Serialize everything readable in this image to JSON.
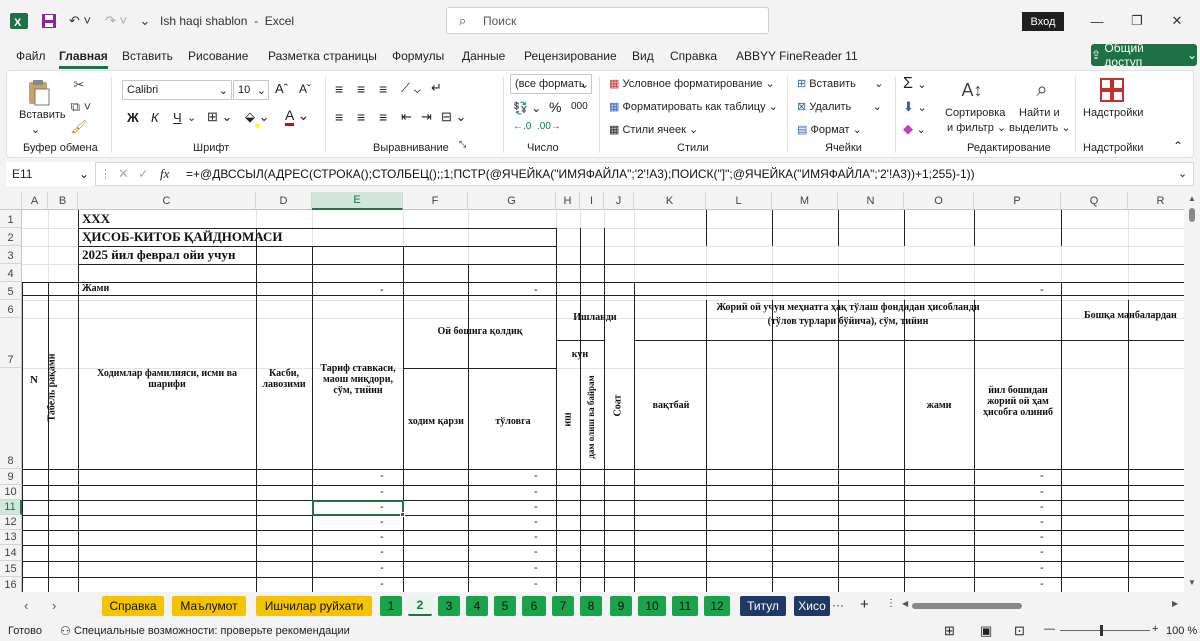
{
  "app": {
    "filename": "Ish haqi shablon",
    "sep": "-",
    "appname": "Excel",
    "search_placeholder": "Поиск",
    "login": "Вход",
    "share": "Общий доступ"
  },
  "menu": [
    "Файл",
    "Главная",
    "Вставить",
    "Рисование",
    "Разметка страницы",
    "Формулы",
    "Данные",
    "Рецензирование",
    "Вид",
    "Справка",
    "ABBYY FineReader 11"
  ],
  "ribbon": {
    "clipboard": {
      "paste": "Вставить",
      "label": "Буфер обмена"
    },
    "font": {
      "name": "Calibri",
      "size": "10",
      "label": "Шрифт",
      "bold": "Ж",
      "italic": "К",
      "underline": "Ч"
    },
    "align": {
      "label": "Выравнивание"
    },
    "number": {
      "format": "(все формать",
      "label": "Число",
      "percent": "%",
      "thousands": "000"
    },
    "styles": {
      "cond": "Условное форматирование",
      "table": "Форматировать как таблицу",
      "cell": "Стили ячеек",
      "label": "Стили"
    },
    "cells": {
      "insert": "Вставить",
      "delete": "Удалить",
      "format": "Формат",
      "label": "Ячейки"
    },
    "editing": {
      "sort1": "Сортировка",
      "sort2": "и фильтр",
      "find1": "Найти и",
      "find2": "выделить",
      "label": "Редактирование"
    },
    "addins": {
      "settings": "Надстройки",
      "label": "Надстройки"
    }
  },
  "formula_bar": {
    "cell": "E11",
    "fx": "fx",
    "formula": "=+@ДВССЫЛ(АДРЕС(СТРОКА();СТОЛБЕЦ();;1;ПСТР(@ЯЧЕЙКА(\"ИМЯФАЙЛА\";'2'!A3);ПОИСК(\"]\";@ЯЧЕЙКА(\"ИМЯФАЙЛА\";'2'!A3))+1;255)-1))"
  },
  "columns": [
    "A",
    "B",
    "C",
    "D",
    "E",
    "F",
    "G",
    "H",
    "I",
    "J",
    "K",
    "L",
    "M",
    "N",
    "O",
    "P",
    "Q",
    "R"
  ],
  "rows": [
    "1",
    "2",
    "3",
    "4",
    "5",
    "6",
    "7",
    "8",
    "9",
    "10",
    "11",
    "12",
    "13",
    "14",
    "15",
    "16"
  ],
  "sheet": {
    "r1": "XXX",
    "r2": "ҲИСОБ-КИТОБ ҚАЙДНОМАСИ",
    "r3": "2025 йил феврал ойи учун",
    "jami": "Жами",
    "dash": "-",
    "N": "N",
    "tabel": "Табель рақами",
    "fio": "Ходимлар фамилияси, исми ва шарифи",
    "kasbi": "Касби, лавозими",
    "tarif": "Тариф ставкаси, маош миқдори, сўм, тийин",
    "oy_bosh": "Ой бошига қолдиқ",
    "xodim_qarzi": "ходим қарзи",
    "tolovga": "тўловга",
    "ishlandi": "Ишланди",
    "kun": "кун",
    "ish": "иш",
    "dam": "дам олиш ва байрам",
    "soat": "Соат",
    "joriy": "Жорий ой учун меҳнатга ҳақ тўлаш фондидан ҳисобланди",
    "joriy2": "(тўлов турлари бўйича), сўм, тийин",
    "vaqtbay": "вақтбай",
    "jami2": "жами",
    "yil_bosh": "йил бошидан жорий ой ҳам ҳисобга олиниб",
    "boshqa": "Бошқа манбалардан"
  },
  "tabs": [
    "Справка",
    "Маълумот",
    "Ишчилар руйхати",
    "1",
    "2",
    "3",
    "4",
    "5",
    "6",
    "7",
    "8",
    "9",
    "10",
    "11",
    "12",
    "Титул",
    "Хисо"
  ],
  "status": {
    "ready": "Готово",
    "access": "Специальные возможности: проверьте рекомендации",
    "zoom": "100 %"
  }
}
